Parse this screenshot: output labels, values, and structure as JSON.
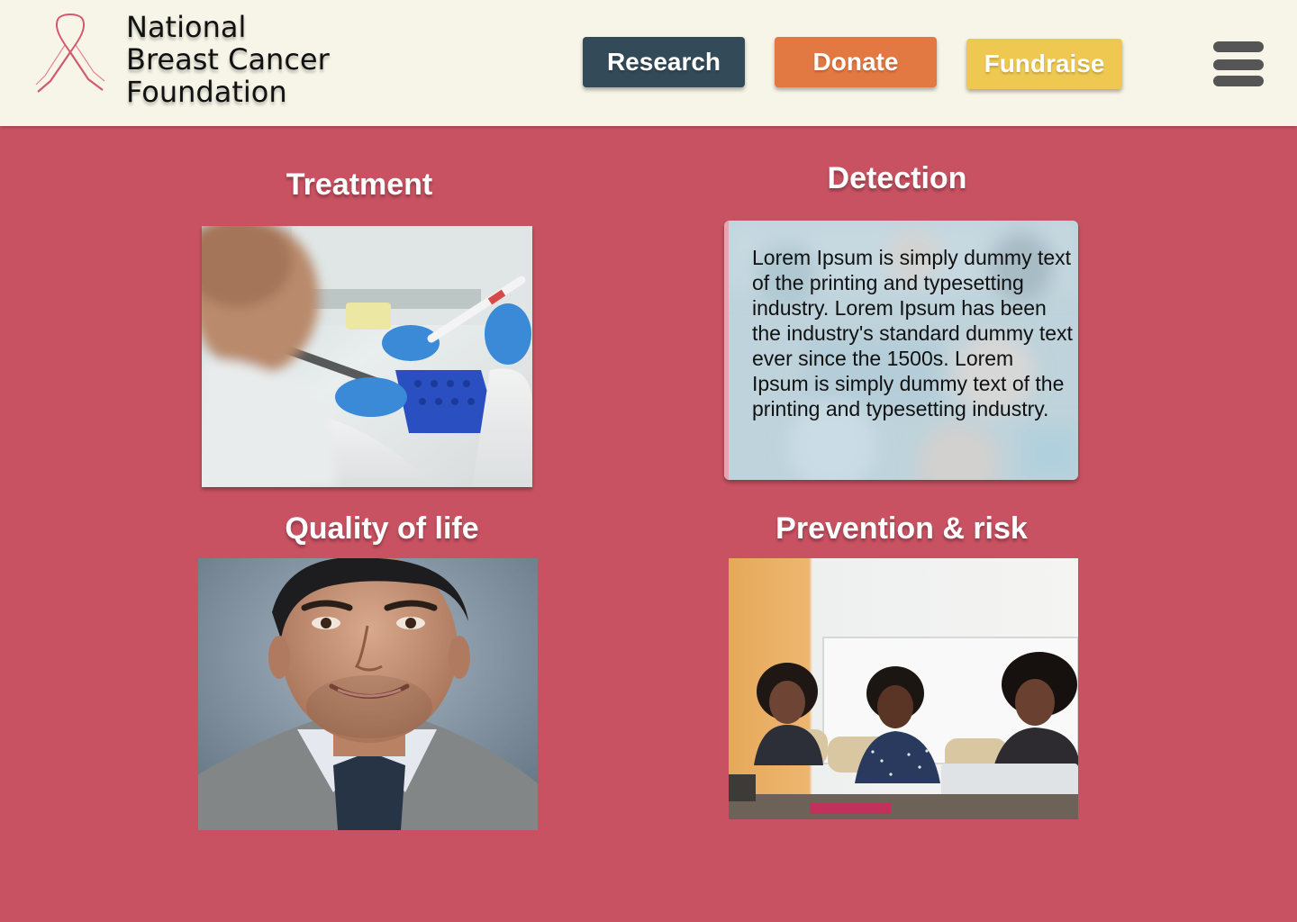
{
  "header": {
    "org_name": [
      "National",
      "Breast Cancer",
      "Foundation"
    ],
    "logo_icon": "pink-ribbon-icon",
    "nav": {
      "research": "Research",
      "donate": "Donate",
      "fundraise": "Fundraise"
    },
    "menu_icon": "hamburger-menu-icon"
  },
  "sections": {
    "treatment": {
      "title": "Treatment",
      "image": "lab-researcher-pipette-photo"
    },
    "detection": {
      "title": "Detection",
      "image": "blurred-lab-background-photo",
      "text": "Lorem Ipsum is simply dummy text of the printing and typesetting industry. Lorem Ipsum has been the industry's standard dummy text ever since the 1500s. Lorem Ipsum is simply dummy text of the printing and typesetting industry."
    },
    "quality": {
      "title": "Quality of life",
      "image": "smiling-man-portrait-photo"
    },
    "prevention": {
      "title": "Prevention & risk",
      "image": "three-women-meeting-photo"
    }
  },
  "colors": {
    "page_background": "#c85262",
    "header_background": "#f7f5e7",
    "research_button": "#334a58",
    "donate_button": "#e27842",
    "fundraise_button": "#eec851",
    "menu_icon": "#555555"
  }
}
